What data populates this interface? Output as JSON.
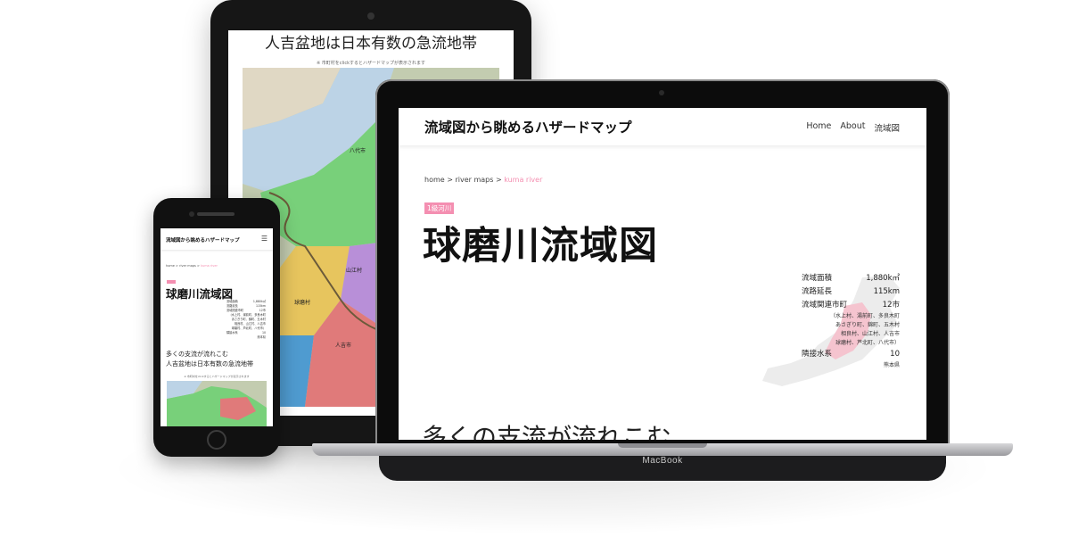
{
  "site": {
    "title": "流域図から眺めるハザードマップ",
    "nav": [
      "Home",
      "About",
      "流域図"
    ]
  },
  "breadcrumb": {
    "items": [
      "home >",
      "river maps >"
    ],
    "current": "kuma river"
  },
  "page": {
    "badge": "1級河川",
    "title": "球磨川流域図"
  },
  "stats": {
    "area_label": "流域面積",
    "area_value": "1,880k㎡",
    "length_label": "流路延長",
    "length_value": "115km",
    "cities_label": "流域関連市町",
    "cities_value": "12市",
    "cities_list": [
      "（水上村、湯前町、多良木町",
      "あさぎり町、錦町、五木村",
      "相良村、山江村、人吉市",
      "球磨村、芦北町、八代市）"
    ],
    "basins_label": "隣接水系",
    "basins_value": "10",
    "prefecture": "熊本県"
  },
  "section": {
    "heading_line1": "多くの支流が流れこむ",
    "heading_line2": "人吉盆地は日本有数の急流地帯",
    "map_note": "※ 市町村をclickするとハザードマップが表示されます"
  },
  "map_labels": {
    "yatsushiro": "八代市",
    "yamae": "山江村",
    "kuma_village": "球磨村",
    "hitoyoshi": "人吉市"
  },
  "devices": {
    "laptop_brand": "MacBook"
  },
  "colors": {
    "accent_pink": "#f48fb1",
    "text_dark": "#111111"
  },
  "icons": {
    "menu": "hamburger-menu-icon"
  }
}
